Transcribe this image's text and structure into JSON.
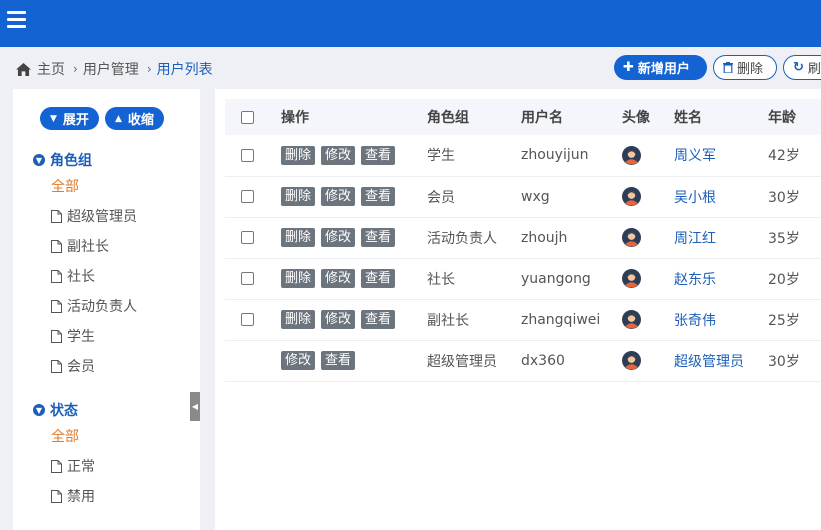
{
  "header": {
    "menu_icon": "hamburger-icon",
    "brand_color": "#1363d3"
  },
  "breadcrumb": {
    "home_icon": "home-icon",
    "items": [
      "主页",
      "用户管理",
      "用户列表"
    ]
  },
  "toolbar": {
    "add_label": "新增用户",
    "delete_label": "删除",
    "refresh_label": "刷新"
  },
  "sidebar": {
    "expand_label": "展开",
    "collapse_label": "收缩",
    "groups": [
      {
        "title": "角色组",
        "items": [
          "全部",
          "超级管理员",
          "副社长",
          "社长",
          "活动负责人",
          "学生",
          "会员"
        ]
      },
      {
        "title": "状态",
        "items": [
          "全部",
          "正常",
          "禁用"
        ]
      }
    ]
  },
  "table": {
    "columns": [
      "操作",
      "角色组",
      "用户名",
      "头像",
      "姓名",
      "年龄"
    ],
    "op_labels": {
      "delete": "删除",
      "edit": "修改",
      "view": "查看"
    },
    "rows": [
      {
        "role": "学生",
        "username": "zhouyijun",
        "name": "周义军",
        "age": "42岁",
        "avatar": "male-avatar-icon"
      },
      {
        "role": "会员",
        "username": "wxg",
        "name": "吴小根",
        "age": "30岁",
        "avatar": "male-avatar-icon"
      },
      {
        "role": "活动负责人",
        "username": "zhoujh",
        "name": "周江红",
        "age": "35岁",
        "avatar": "male-avatar-icon"
      },
      {
        "role": "社长",
        "username": "yuangong",
        "name": "赵东乐",
        "age": "20岁",
        "avatar": "male-avatar-icon"
      },
      {
        "role": "副社长",
        "username": "zhangqiwei",
        "name": "张奇伟",
        "age": "25岁",
        "avatar": "male-avatar-icon"
      },
      {
        "role": "超级管理员",
        "username": "dx360",
        "name": "超级管理员",
        "age": "30岁",
        "avatar": "male-avatar-icon"
      }
    ]
  }
}
